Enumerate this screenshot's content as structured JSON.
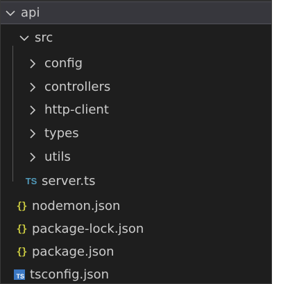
{
  "tree": {
    "root": {
      "label": "api",
      "expanded": true
    },
    "src": {
      "label": "src",
      "expanded": true
    },
    "folders": [
      {
        "label": "config",
        "expanded": false
      },
      {
        "label": "controllers",
        "expanded": false
      },
      {
        "label": "http-client",
        "expanded": false
      },
      {
        "label": "types",
        "expanded": false
      },
      {
        "label": "utils",
        "expanded": false
      }
    ],
    "src_files": [
      {
        "label": "server.ts",
        "icon": "typescript-icon",
        "icon_text": "TS"
      }
    ],
    "root_files": [
      {
        "label": "nodemon.json",
        "icon": "json-icon",
        "icon_text": "{}"
      },
      {
        "label": "package-lock.json",
        "icon": "json-icon",
        "icon_text": "{}"
      },
      {
        "label": "package.json",
        "icon": "json-icon",
        "icon_text": "{}"
      },
      {
        "label": "tsconfig.json",
        "icon": "tsconfig-icon",
        "icon_text": "TS"
      }
    ]
  },
  "colors": {
    "background": "#1e1e1e",
    "text": "#cccccc",
    "json_icon": "#cbcb41",
    "ts_icon": "#519aba",
    "tsconfig_icon_bg": "#3b78c4",
    "selected_row": "#37373d"
  }
}
